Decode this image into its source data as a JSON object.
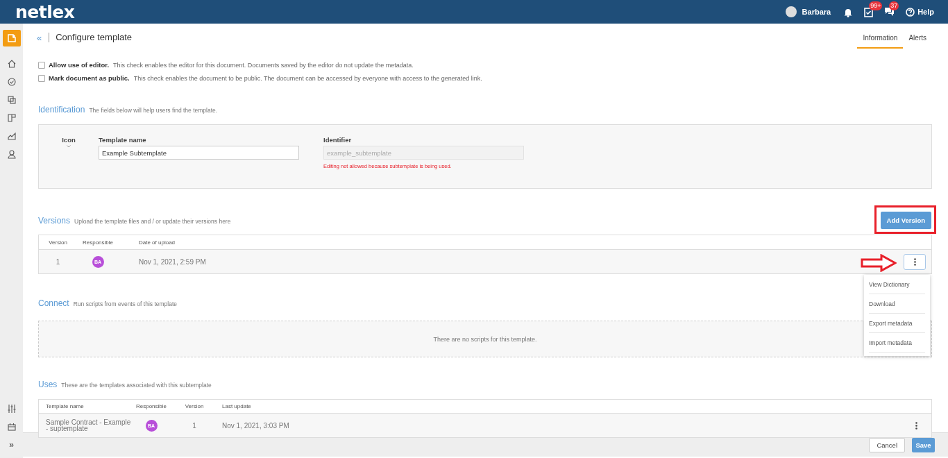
{
  "header": {
    "logo": "netlex",
    "user": "Barbara",
    "tasks_badge": "99+",
    "messages_badge": "37",
    "help": "Help"
  },
  "sidebar": {
    "expand": "»"
  },
  "page": {
    "back": "«",
    "title": "Configure template",
    "tabs": [
      {
        "label": "Information",
        "selected": true
      },
      {
        "label": "Alerts",
        "selected": false
      }
    ]
  },
  "options": [
    {
      "label": "Allow use of editor.",
      "description": "This check enables the editor for this document. Documents saved by the editor do not update the metadata.",
      "checked": false
    },
    {
      "label": "Mark document as public.",
      "description": "This check enables the document to be public. The document can be accessed by everyone with access to the generated link.",
      "checked": false
    }
  ],
  "identification": {
    "title": "Identification",
    "subtitle": "The fields below will help users find the template.",
    "icon_label": "Icon",
    "template_name": {
      "label": "Template name",
      "value": "Example Subtemplate"
    },
    "identifier": {
      "label": "Identifier",
      "value": "example_subtemplate",
      "disabled": true,
      "error": "Editing not allowed because subtemplate is being used."
    }
  },
  "versions": {
    "title": "Versions",
    "subtitle": "Upload the template files and / or update their versions here",
    "add_button": "Add Version",
    "columns": [
      "Version",
      "Responsible",
      "Date of upload"
    ],
    "rows": [
      {
        "version": "1",
        "responsible": "BA",
        "date": "Nov 1, 2021, 2:59 PM"
      }
    ]
  },
  "menu": {
    "items": [
      "View Dictionary",
      "Download",
      "Export metadata",
      "Import metadata"
    ]
  },
  "connect": {
    "title": "Connect",
    "subtitle": "Run scripts from events of this template",
    "empty": "There are no scripts for this template."
  },
  "uses": {
    "title": "Uses",
    "subtitle": "These are the templates associated with this subtemplate",
    "columns": [
      "Template name",
      "Responsible",
      "Version",
      "Last update"
    ],
    "rows": [
      {
        "template_name": "Sample Contract - Example - suptemplate",
        "responsible": "BA",
        "version": "1",
        "last_update": "Nov 1, 2021, 3:03 PM"
      }
    ]
  },
  "footer": {
    "buttons": [
      {
        "label": "Cancel",
        "kind": "secondary"
      },
      {
        "label": "Save",
        "kind": "primary"
      }
    ]
  }
}
